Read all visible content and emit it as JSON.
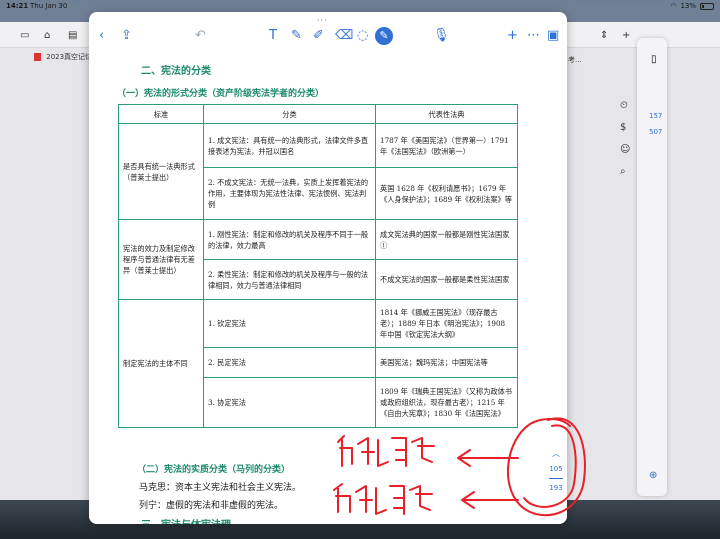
{
  "status_bar": {
    "time": "14:21",
    "date": "Thu Jan 30",
    "battery": "13%"
  },
  "background_window": {
    "doc_tab": "2023真空记忆...",
    "right_peek_label": "考...",
    "page_numbers": [
      "157",
      "507"
    ]
  },
  "toolbar": {
    "icons": [
      "back-icon",
      "share-icon",
      "undo-icon",
      "text-icon",
      "pen-icon",
      "highlighter-icon",
      "eraser-icon",
      "lasso-icon",
      "shapes-icon",
      "active-pen-icon",
      "microphone-icon",
      "add-icon",
      "more-icon",
      "pages-icon"
    ],
    "more_label": "···"
  },
  "document": {
    "section_title": "二、宪法的分类",
    "subsection_title": "（一）宪法的形式分类（资产阶级宪法学者的分类）",
    "table": {
      "headers": [
        "标准",
        "分类",
        "代表性法典"
      ],
      "groups": [
        {
          "criterion": "是否具有统一法典形式（普莱士提出）",
          "rows": [
            {
              "cls": "1. 成文宪法：具有统一的法典形式，法律文件多直接表述为宪法，并冠以国名",
              "examples": "1787 年《美国宪法》（世界第一）1791 年《法国宪法》（欧洲第一）"
            },
            {
              "cls": "2. 不成文宪法：无统一法典，实质上发挥着宪法的作用，主要体现为宪法性法律、宪法惯例、宪法判例",
              "examples": "英国 1628 年《权利请愿书》；1679 年《人身保护法》；1689 年《权利法案》等"
            }
          ]
        },
        {
          "criterion": "宪法的效力及制定修改程序与普通法律有无差异（普莱士提出）",
          "rows": [
            {
              "cls": "1. 刚性宪法：制定和修改的机关及程序不同于一般的法律，效力最高",
              "examples": "成文宪法典的国家一般都是刚性宪法国家①"
            },
            {
              "cls": "2. 柔性宪法：制定和修改的机关及程序与一般的法律相同，效力与普通法律相同",
              "examples": "不成文宪法的国家一般都是柔性宪法国家"
            }
          ]
        },
        {
          "criterion": "制定宪法的主体不同",
          "rows": [
            {
              "cls": "1. 钦定宪法",
              "examples": "1814 年《挪威王国宪法》（现存最古老）；1889 年日本《明治宪法》；1908 年中国《钦定宪法大纲》"
            },
            {
              "cls": "2. 民定宪法",
              "examples": "美国宪法；魏玛宪法；中国宪法等"
            },
            {
              "cls": "3. 协定宪法",
              "examples": "1809 年《瑞典王国宪法》（又称为政体书或政府组织法，现存最古老）；1215 年《自由大宪章》；1830 年《法国宪法》"
            }
          ]
        }
      ]
    },
    "subsection2_title": "（二）宪法的实质分类（马列的分类）",
    "para1": "马克思：资本主义宪法和社会主义宪法。",
    "para2": "列宁：虚假的宪法和非虚假的宪法。",
    "section3_title": "三、宪法与体宪法理"
  },
  "pager": {
    "current": "105",
    "total": "193"
  },
  "side_tools": [
    "timer-icon",
    "dollar-icon",
    "emoji-icon",
    "search-icon"
  ],
  "colors": {
    "accent": "#2f6fd6",
    "heading_green": "#1c8a6d",
    "table_border": "#2a9e7c",
    "ink_red": "#e8202a"
  }
}
